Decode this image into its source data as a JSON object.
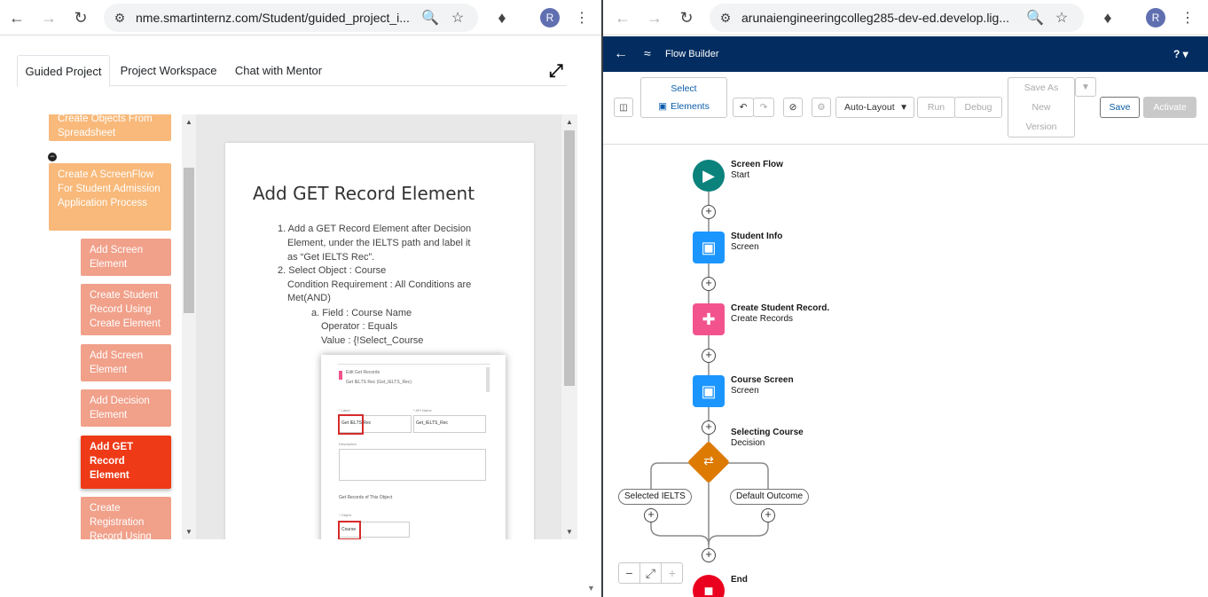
{
  "left_browser": {
    "url": "nme.smartinternz.com/Student/guided_project_i...",
    "profile_initial": "R"
  },
  "right_browser": {
    "url": "arunaiengineeringcolleg285-dev-ed.develop.lig...",
    "profile_initial": "R"
  },
  "guided": {
    "tabs": [
      "Guided Project",
      "Project Workspace",
      "Chat with Mentor"
    ],
    "active_tab": "Guided Project",
    "steps": [
      {
        "label": "Create Objects From Spreadsheet",
        "style": "orange"
      },
      {
        "label": "Create A ScreenFlow For Student Admission Application Process",
        "style": "orange"
      },
      {
        "label": "Add Screen Element",
        "style": "salmon"
      },
      {
        "label": "Create Student Record Using Create Element",
        "style": "salmon"
      },
      {
        "label": "Add Screen Element",
        "style": "salmon"
      },
      {
        "label": "Add Decision Element",
        "style": "salmon"
      },
      {
        "label": "Add GET Record Element",
        "style": "active"
      },
      {
        "label": "Create Registration Record Using",
        "style": "salmon"
      }
    ]
  },
  "doc": {
    "title": "Add GET Record Element",
    "item1": "1. Add a GET Record Element after Decision",
    "item1b": "Element, under the IELTS path and label it",
    "item1c": "as “Get IELTS Rec”.",
    "item2": "2. Select Object : Course",
    "item2b": "Condition Requirement : All Conditions are",
    "item2c": "Met(AND)",
    "sub_a": "a. Field : Course Name",
    "sub_b": "Operator : Equals",
    "sub_c": "Value : {!Select_Course",
    "shot": {
      "header1": "Edit Get Records",
      "header2": "Get IELTS Rec (Get_IELTS_Rec)",
      "label_lbl": "* Label",
      "label_val": "Get IELTS Rec",
      "api_lbl": "* API Name",
      "api_val": "Get_IELTS_Rec",
      "desc_lbl": "Description",
      "section": "Get Records of This Object",
      "object_lbl": "* Object",
      "object_val": "Course"
    }
  },
  "flow_builder": {
    "app_title": "Flow Builder",
    "help": "?",
    "toolbar": {
      "select_line1": "Select",
      "select_line2": "Elements",
      "layout": "Auto-Layout",
      "run": "Run",
      "debug": "Debug",
      "save_as_line1": "Save As",
      "save_as_line2": "New",
      "save_as_line3": "Version",
      "save": "Save",
      "activate": "Activate"
    },
    "nodes": [
      {
        "title": "Screen Flow",
        "subtitle": "Start",
        "color": "#0b827c"
      },
      {
        "title": "Student Info",
        "subtitle": "Screen",
        "color": "#1b96ff"
      },
      {
        "title": "Create Student Record.",
        "subtitle": "Create Records",
        "color": "#f2538d"
      },
      {
        "title": "Course Screen",
        "subtitle": "Screen",
        "color": "#1b96ff"
      },
      {
        "title": "Selecting Course",
        "subtitle": "Decision",
        "color": "#dd7a01"
      },
      {
        "title": "End",
        "subtitle": "",
        "color": "#ea001e"
      }
    ],
    "outcomes": [
      "Selected IELTS",
      "Default Outcome"
    ]
  }
}
